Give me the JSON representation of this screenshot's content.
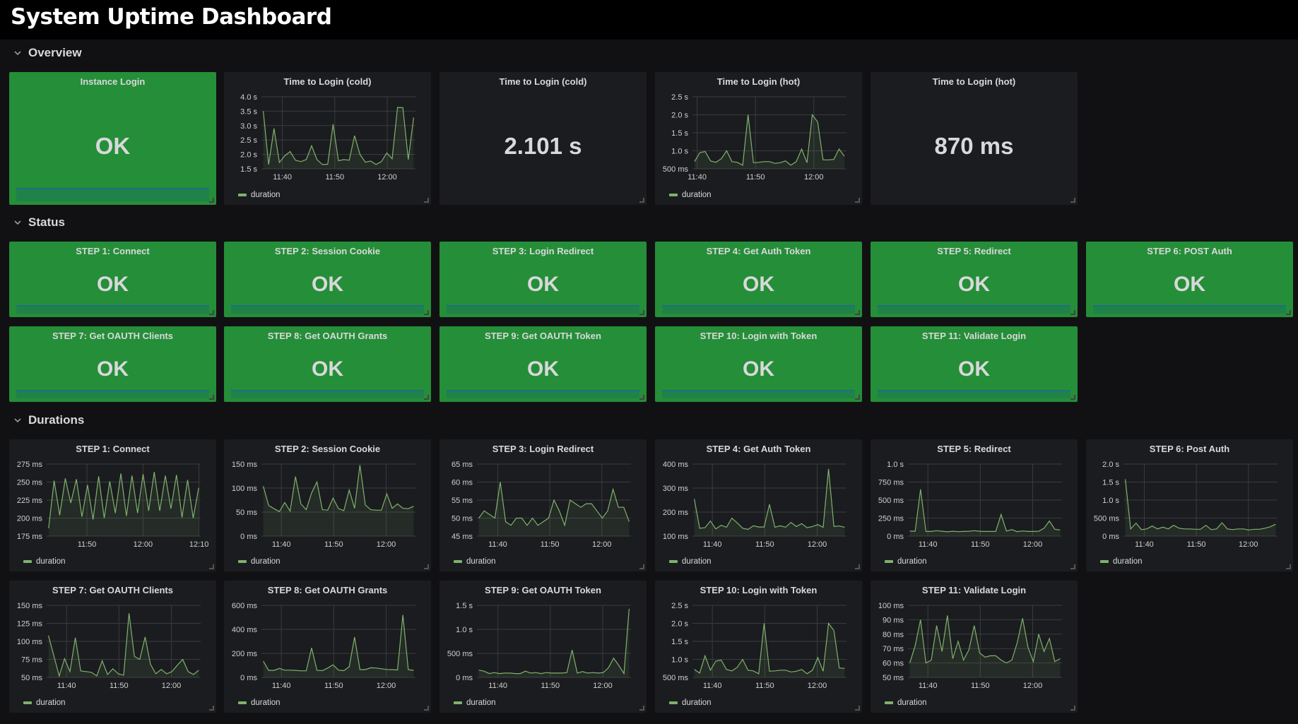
{
  "header": {
    "title": "System Uptime Dashboard"
  },
  "colors": {
    "ok_panel": "#258e38",
    "series_line": "#7eb26d",
    "series_fill": "#7eb26d",
    "panel_bg": "#1b1c1f",
    "page_bg": "#111113",
    "bar_bottom": "#1f8249",
    "bar_line": "#1e6f86"
  },
  "rows": [
    {
      "id": "overview",
      "label": "Overview",
      "icon": "chevron-down-icon"
    },
    {
      "id": "status",
      "label": "Status",
      "icon": "chevron-down-icon"
    },
    {
      "id": "durations",
      "label": "Durations",
      "icon": "chevron-down-icon"
    }
  ],
  "overview": {
    "instance_login": {
      "title": "Instance Login",
      "value": "OK"
    },
    "cold_stat": {
      "title": "Time to Login (cold)",
      "value": "2.101 s"
    },
    "hot_stat": {
      "title": "Time to Login (hot)",
      "value": "870 ms"
    }
  },
  "status_panels": [
    {
      "title": "STEP 1: Connect",
      "value": "OK"
    },
    {
      "title": "STEP 2: Session Cookie",
      "value": "OK"
    },
    {
      "title": "STEP 3: Login Redirect",
      "value": "OK"
    },
    {
      "title": "STEP 4: Get Auth Token",
      "value": "OK"
    },
    {
      "title": "STEP 5: Redirect",
      "value": "OK"
    },
    {
      "title": "STEP 6: POST Auth",
      "value": "OK"
    },
    {
      "title": "STEP 7: Get OAUTH Clients",
      "value": "OK"
    },
    {
      "title": "STEP 8: Get OAUTH Grants",
      "value": "OK"
    },
    {
      "title": "STEP 9: Get OAUTH Token",
      "value": "OK"
    },
    {
      "title": "STEP 10: Login with Token",
      "value": "OK"
    },
    {
      "title": "STEP 11: Validate Login",
      "value": "OK"
    }
  ],
  "chart_data": [
    {
      "id": "cold",
      "type": "area",
      "title": "Time to Login (cold)",
      "legend": [
        "duration"
      ],
      "legend_placement": "bottom-left",
      "xlabel": "",
      "ylabel": "",
      "x_ticks": [
        {
          "min": 0,
          "label": "11:40"
        },
        {
          "min": 10,
          "label": "11:50"
        },
        {
          "min": 20,
          "label": "12:00"
        }
      ],
      "x_range_min": [
        -4,
        25.4
      ],
      "y_ticks": [
        {
          "v": 1.5,
          "label": "1.5 s"
        },
        {
          "v": 2.0,
          "label": "2.0 s"
        },
        {
          "v": 2.5,
          "label": "2.5 s"
        },
        {
          "v": 3.0,
          "label": "3.0 s"
        },
        {
          "v": 3.5,
          "label": "3.5 s"
        },
        {
          "v": 4.0,
          "label": "4.0 s"
        }
      ],
      "ylim": [
        1.5,
        4.0
      ],
      "unit": "s",
      "values": [
        3.5,
        1.65,
        2.9,
        1.72,
        1.95,
        2.1,
        1.8,
        1.75,
        1.82,
        2.3,
        1.82,
        1.65,
        1.66,
        3.05,
        1.78,
        1.82,
        1.8,
        2.65,
        2.0,
        1.73,
        1.77,
        1.65,
        1.75,
        2.05,
        1.85,
        3.63,
        3.62,
        1.82,
        3.28
      ]
    },
    {
      "id": "hot",
      "type": "area",
      "title": "Time to Login (hot)",
      "legend": [
        "duration"
      ],
      "legend_placement": "bottom-left",
      "x_ticks": [
        {
          "min": 0,
          "label": "11:40"
        },
        {
          "min": 10,
          "label": "11:50"
        },
        {
          "min": 20,
          "label": "12:00"
        }
      ],
      "x_range_min": [
        -0.8,
        25.6
      ],
      "y_ticks": [
        {
          "v": 0.5,
          "label": "500 ms"
        },
        {
          "v": 1.0,
          "label": "1.0 s"
        },
        {
          "v": 1.5,
          "label": "1.5 s"
        },
        {
          "v": 2.0,
          "label": "2.0 s"
        },
        {
          "v": 2.5,
          "label": "2.5 s"
        }
      ],
      "ylim": [
        0.5,
        2.5
      ],
      "unit": "s",
      "values": [
        0.7,
        0.95,
        0.98,
        0.72,
        0.68,
        0.78,
        1.0,
        0.7,
        0.68,
        0.6,
        2.0,
        0.67,
        0.68,
        0.7,
        0.7,
        0.65,
        0.67,
        0.72,
        0.6,
        0.7,
        1.05,
        0.67,
        2.0,
        1.8,
        0.75,
        0.75,
        0.76,
        1.05,
        0.85
      ]
    },
    {
      "id": "d1",
      "type": "area",
      "title": "STEP 1: Connect",
      "legend": [
        "duration"
      ],
      "x_ticks": [
        {
          "min": 10,
          "label": "11:50"
        },
        {
          "min": 20,
          "label": "12:00"
        },
        {
          "min": 30,
          "label": "12:10"
        }
      ],
      "x_range_min": [
        2.8,
        30.3
      ],
      "y_ticks": [
        {
          "v": 175,
          "label": "175 ms"
        },
        {
          "v": 200,
          "label": "200 ms"
        },
        {
          "v": 225,
          "label": "225 ms"
        },
        {
          "v": 250,
          "label": "250 ms"
        },
        {
          "v": 275,
          "label": "275 ms"
        }
      ],
      "ylim": [
        175,
        275
      ],
      "unit": "ms",
      "values": [
        186,
        252,
        204,
        255,
        221,
        254,
        202,
        246,
        198,
        258,
        200,
        251,
        207,
        262,
        203,
        259,
        207,
        261,
        210,
        264,
        210,
        259,
        213,
        260,
        201,
        253,
        200,
        242
      ]
    },
    {
      "id": "d2",
      "type": "area",
      "title": "STEP 2: Session Cookie",
      "legend": [
        "duration"
      ],
      "x_ticks": [
        {
          "min": 0,
          "label": "11:40"
        },
        {
          "min": 10,
          "label": "11:50"
        },
        {
          "min": 20,
          "label": "12:00"
        }
      ],
      "x_range_min": [
        -3.8,
        25.6
      ],
      "y_ticks": [
        {
          "v": 0,
          "label": "0 ms"
        },
        {
          "v": 50,
          "label": "50 ms"
        },
        {
          "v": 100,
          "label": "100 ms"
        },
        {
          "v": 150,
          "label": "150 ms"
        }
      ],
      "ylim": [
        0,
        150
      ],
      "unit": "ms",
      "values": [
        104,
        64,
        57,
        51,
        70,
        52,
        124,
        67,
        55,
        90,
        113,
        55,
        54,
        79,
        57,
        53,
        96,
        58,
        148,
        65,
        55,
        54,
        54,
        88,
        58,
        67,
        58,
        57,
        62
      ]
    },
    {
      "id": "d3",
      "type": "area",
      "title": "STEP 3: Login Redirect",
      "legend": [
        "duration"
      ],
      "x_ticks": [
        {
          "min": 0,
          "label": "11:40"
        },
        {
          "min": 10,
          "label": "11:50"
        },
        {
          "min": 20,
          "label": "12:00"
        }
      ],
      "x_range_min": [
        -4,
        25.6
      ],
      "y_ticks": [
        {
          "v": 45,
          "label": "45 ms"
        },
        {
          "v": 50,
          "label": "50 ms"
        },
        {
          "v": 55,
          "label": "55 ms"
        },
        {
          "v": 60,
          "label": "60 ms"
        },
        {
          "v": 65,
          "label": "65 ms"
        }
      ],
      "ylim": [
        45,
        65
      ],
      "unit": "ms",
      "values": [
        50,
        52,
        51,
        50,
        60,
        49,
        48,
        50,
        50,
        48,
        50,
        48,
        49,
        50,
        55,
        52,
        48,
        55,
        54,
        53,
        54,
        54,
        52,
        50,
        52,
        58,
        53,
        53,
        49
      ]
    },
    {
      "id": "d4",
      "type": "area",
      "title": "STEP 4: Get Auth Token",
      "legend": [
        "duration"
      ],
      "x_ticks": [
        {
          "min": 0,
          "label": "11:40"
        },
        {
          "min": 10,
          "label": "11:50"
        },
        {
          "min": 20,
          "label": "12:00"
        }
      ],
      "x_range_min": [
        -3.8,
        25.6
      ],
      "y_ticks": [
        {
          "v": 100,
          "label": "100 ms"
        },
        {
          "v": 200,
          "label": "200 ms"
        },
        {
          "v": 300,
          "label": "300 ms"
        },
        {
          "v": 400,
          "label": "400 ms"
        }
      ],
      "ylim": [
        100,
        400
      ],
      "unit": "ms",
      "values": [
        255,
        133,
        135,
        163,
        130,
        145,
        137,
        175,
        155,
        133,
        128,
        143,
        138,
        138,
        232,
        137,
        143,
        137,
        157,
        140,
        152,
        135,
        140,
        148,
        137,
        380,
        140,
        142,
        137
      ]
    },
    {
      "id": "d5",
      "type": "area",
      "title": "STEP 5: Redirect",
      "legend": [
        "duration"
      ],
      "x_ticks": [
        {
          "min": 0,
          "label": "11:40"
        },
        {
          "min": 10,
          "label": "11:50"
        },
        {
          "min": 20,
          "label": "12:00"
        }
      ],
      "x_range_min": [
        -3.8,
        25.6
      ],
      "y_ticks": [
        {
          "v": 0,
          "label": "0 ms"
        },
        {
          "v": 250,
          "label": "250 ms"
        },
        {
          "v": 500,
          "label": "500 ms"
        },
        {
          "v": 750,
          "label": "750 ms"
        },
        {
          "v": 1000,
          "label": "1.0 s"
        }
      ],
      "ylim": [
        0,
        1000
      ],
      "unit": "ms",
      "values": [
        70,
        68,
        650,
        65,
        65,
        75,
        68,
        60,
        68,
        62,
        65,
        68,
        75,
        68,
        65,
        65,
        65,
        300,
        70,
        90,
        62,
        72,
        65,
        65,
        68,
        110,
        210,
        95,
        85
      ]
    },
    {
      "id": "d6",
      "type": "area",
      "title": "STEP 6: Post Auth",
      "legend": [
        "duration"
      ],
      "x_ticks": [
        {
          "min": 0,
          "label": "11:40"
        },
        {
          "min": 10,
          "label": "11:50"
        },
        {
          "min": 20,
          "label": "12:00"
        }
      ],
      "x_range_min": [
        -4,
        25.6
      ],
      "y_ticks": [
        {
          "v": 0,
          "label": "0 ms"
        },
        {
          "v": 0.5,
          "label": "500 ms"
        },
        {
          "v": 1.0,
          "label": "1.0 s"
        },
        {
          "v": 1.5,
          "label": "1.5 s"
        },
        {
          "v": 2.0,
          "label": "2.0 s"
        }
      ],
      "ylim": [
        0,
        2.0
      ],
      "unit": "s",
      "values": [
        1.58,
        0.2,
        0.36,
        0.18,
        0.2,
        0.28,
        0.2,
        0.25,
        0.2,
        0.3,
        0.22,
        0.2,
        0.2,
        0.19,
        0.19,
        0.3,
        0.18,
        0.2,
        0.37,
        0.2,
        0.18,
        0.2,
        0.2,
        0.17,
        0.19,
        0.19,
        0.22,
        0.26,
        0.33
      ]
    },
    {
      "id": "d7",
      "type": "area",
      "title": "STEP 7: Get OAUTH Clients",
      "legend": [
        "duration"
      ],
      "x_ticks": [
        {
          "min": 0,
          "label": "11:40"
        },
        {
          "min": 10,
          "label": "11:50"
        },
        {
          "min": 20,
          "label": "12:00"
        }
      ],
      "x_range_min": [
        -3.8,
        25.6
      ],
      "y_ticks": [
        {
          "v": 50,
          "label": "50 ms"
        },
        {
          "v": 75,
          "label": "75 ms"
        },
        {
          "v": 100,
          "label": "100 ms"
        },
        {
          "v": 125,
          "label": "125 ms"
        },
        {
          "v": 150,
          "label": "150 ms"
        }
      ],
      "ylim": [
        50,
        150
      ],
      "unit": "ms",
      "values": [
        108,
        80,
        52,
        76,
        58,
        105,
        59,
        58,
        57,
        52,
        73,
        54,
        62,
        55,
        53,
        139,
        79,
        75,
        106,
        68,
        55,
        61,
        55,
        58,
        67,
        75,
        58,
        54,
        60
      ]
    },
    {
      "id": "d8",
      "type": "area",
      "title": "STEP 8: Get OAUTH Grants",
      "legend": [
        "duration"
      ],
      "x_ticks": [
        {
          "min": 0,
          "label": "11:40"
        },
        {
          "min": 10,
          "label": "11:50"
        },
        {
          "min": 20,
          "label": "12:00"
        }
      ],
      "x_range_min": [
        -3.8,
        25.6
      ],
      "y_ticks": [
        {
          "v": 0,
          "label": "0 ms"
        },
        {
          "v": 200,
          "label": "200 ms"
        },
        {
          "v": 400,
          "label": "400 ms"
        },
        {
          "v": 600,
          "label": "600 ms"
        }
      ],
      "ylim": [
        0,
        600
      ],
      "unit": "ms",
      "values": [
        135,
        58,
        58,
        75,
        60,
        60,
        58,
        55,
        55,
        245,
        58,
        56,
        78,
        105,
        60,
        56,
        88,
        335,
        65,
        65,
        80,
        78,
        72,
        66,
        65,
        62,
        520,
        65,
        58
      ]
    },
    {
      "id": "d9",
      "type": "area",
      "title": "STEP 9: Get OAUTH Token",
      "legend": [
        "duration"
      ],
      "x_ticks": [
        {
          "min": 0,
          "label": "11:40"
        },
        {
          "min": 10,
          "label": "11:50"
        },
        {
          "min": 20,
          "label": "12:00"
        }
      ],
      "x_range_min": [
        -4,
        25.4
      ],
      "y_ticks": [
        {
          "v": 0,
          "label": "0 ms"
        },
        {
          "v": 0.5,
          "label": "500 ms"
        },
        {
          "v": 1.0,
          "label": "1.0 s"
        },
        {
          "v": 1.5,
          "label": "1.5 s"
        }
      ],
      "ylim": [
        0,
        1.5
      ],
      "unit": "s",
      "values": [
        0.15,
        0.13,
        0.08,
        0.1,
        0.08,
        0.09,
        0.09,
        0.08,
        0.08,
        0.13,
        0.09,
        0.1,
        0.08,
        0.1,
        0.09,
        0.09,
        0.09,
        0.1,
        0.57,
        0.09,
        0.12,
        0.09,
        0.1,
        0.09,
        0.1,
        0.2,
        0.4,
        0.25,
        0.08,
        1.43
      ]
    },
    {
      "id": "d10",
      "type": "area",
      "title": "STEP 10: Login with Token",
      "legend": [
        "duration"
      ],
      "x_ticks": [
        {
          "min": 0,
          "label": "11:40"
        },
        {
          "min": 10,
          "label": "11:50"
        },
        {
          "min": 20,
          "label": "12:00"
        }
      ],
      "x_range_min": [
        -3.8,
        25.6
      ],
      "y_ticks": [
        {
          "v": 0.5,
          "label": "500 ms"
        },
        {
          "v": 1.0,
          "label": "1.0 s"
        },
        {
          "v": 1.5,
          "label": "1.5 s"
        },
        {
          "v": 2.0,
          "label": "2.0 s"
        },
        {
          "v": 2.5,
          "label": "2.5 s"
        }
      ],
      "ylim": [
        0.5,
        2.5
      ],
      "unit": "s",
      "values": [
        0.72,
        0.62,
        1.1,
        0.7,
        0.95,
        0.98,
        0.72,
        0.68,
        0.78,
        1.0,
        0.7,
        0.68,
        0.6,
        2.0,
        0.67,
        0.68,
        0.7,
        0.7,
        0.65,
        0.67,
        0.72,
        0.6,
        0.7,
        1.05,
        0.67,
        2.0,
        1.8,
        0.76,
        0.75
      ]
    },
    {
      "id": "d11",
      "type": "area",
      "title": "STEP 11: Validate Login",
      "legend": [
        "duration"
      ],
      "x_ticks": [
        {
          "min": 0,
          "label": "11:40"
        },
        {
          "min": 10,
          "label": "11:50"
        },
        {
          "min": 20,
          "label": "12:00"
        }
      ],
      "x_range_min": [
        -3.8,
        25.6
      ],
      "y_ticks": [
        {
          "v": 50,
          "label": "50 ms"
        },
        {
          "v": 60,
          "label": "60 ms"
        },
        {
          "v": 70,
          "label": "70 ms"
        },
        {
          "v": 80,
          "label": "80 ms"
        },
        {
          "v": 90,
          "label": "90 ms"
        },
        {
          "v": 100,
          "label": "100 ms"
        }
      ],
      "ylim": [
        50,
        100
      ],
      "unit": "ms",
      "values": [
        60,
        72,
        90,
        60,
        62,
        86,
        68,
        93,
        63,
        75,
        62,
        69,
        86,
        67,
        64,
        65,
        65,
        62,
        60,
        62,
        74,
        91,
        71,
        61,
        80,
        68,
        77,
        61,
        63
      ]
    }
  ]
}
